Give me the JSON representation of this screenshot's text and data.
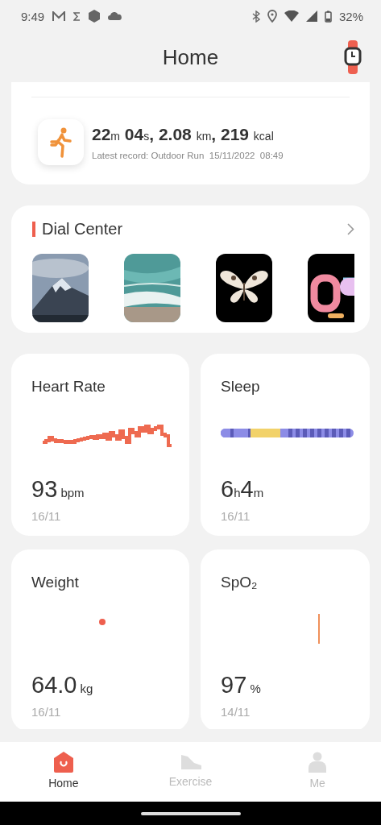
{
  "status_bar": {
    "time": "9:49",
    "battery": "32%"
  },
  "header": {
    "title": "Home"
  },
  "workout": {
    "summary": [
      {
        "text": "22",
        "kind": "num"
      },
      {
        "text": "m",
        "kind": "unit"
      },
      {
        "text": " 04",
        "kind": "num"
      },
      {
        "text": "s",
        "kind": "unit"
      },
      {
        "text": ", 2.08 ",
        "kind": "num"
      },
      {
        "text": "km",
        "kind": "unit"
      },
      {
        "text": ", 219 ",
        "kind": "num"
      },
      {
        "text": "kcal",
        "kind": "unit"
      }
    ],
    "detail": "Latest record: Outdoor Run  15/11/2022  08:49"
  },
  "dial_center": {
    "title": "Dial Center"
  },
  "metrics": [
    {
      "title": "Heart Rate",
      "kind": "line",
      "value": [
        {
          "text": "93",
          "kind": "num"
        },
        {
          "text": " bpm",
          "kind": "unit"
        }
      ],
      "date": "16/11"
    },
    {
      "title": "Sleep",
      "kind": "sleep",
      "value": [
        {
          "text": "6",
          "kind": "num"
        },
        {
          "text": "h",
          "kind": "unit"
        },
        {
          "text": "4",
          "kind": "num"
        },
        {
          "text": "m",
          "kind": "unit"
        }
      ],
      "date": "16/11"
    },
    {
      "title": "Weight",
      "kind": "dot",
      "value": [
        {
          "text": "64.0",
          "kind": "num"
        },
        {
          "text": " kg",
          "kind": "unit"
        }
      ],
      "date": "16/11"
    },
    {
      "title": "SpO₂",
      "kind": "bar",
      "value": [
        {
          "text": "97",
          "kind": "num"
        },
        {
          "text": " %",
          "kind": "unit"
        }
      ],
      "date": "14/11"
    }
  ],
  "nav": [
    {
      "label": "Home",
      "selected": true
    },
    {
      "label": "Exercise",
      "selected": false
    },
    {
      "label": "Me",
      "selected": false
    }
  ]
}
